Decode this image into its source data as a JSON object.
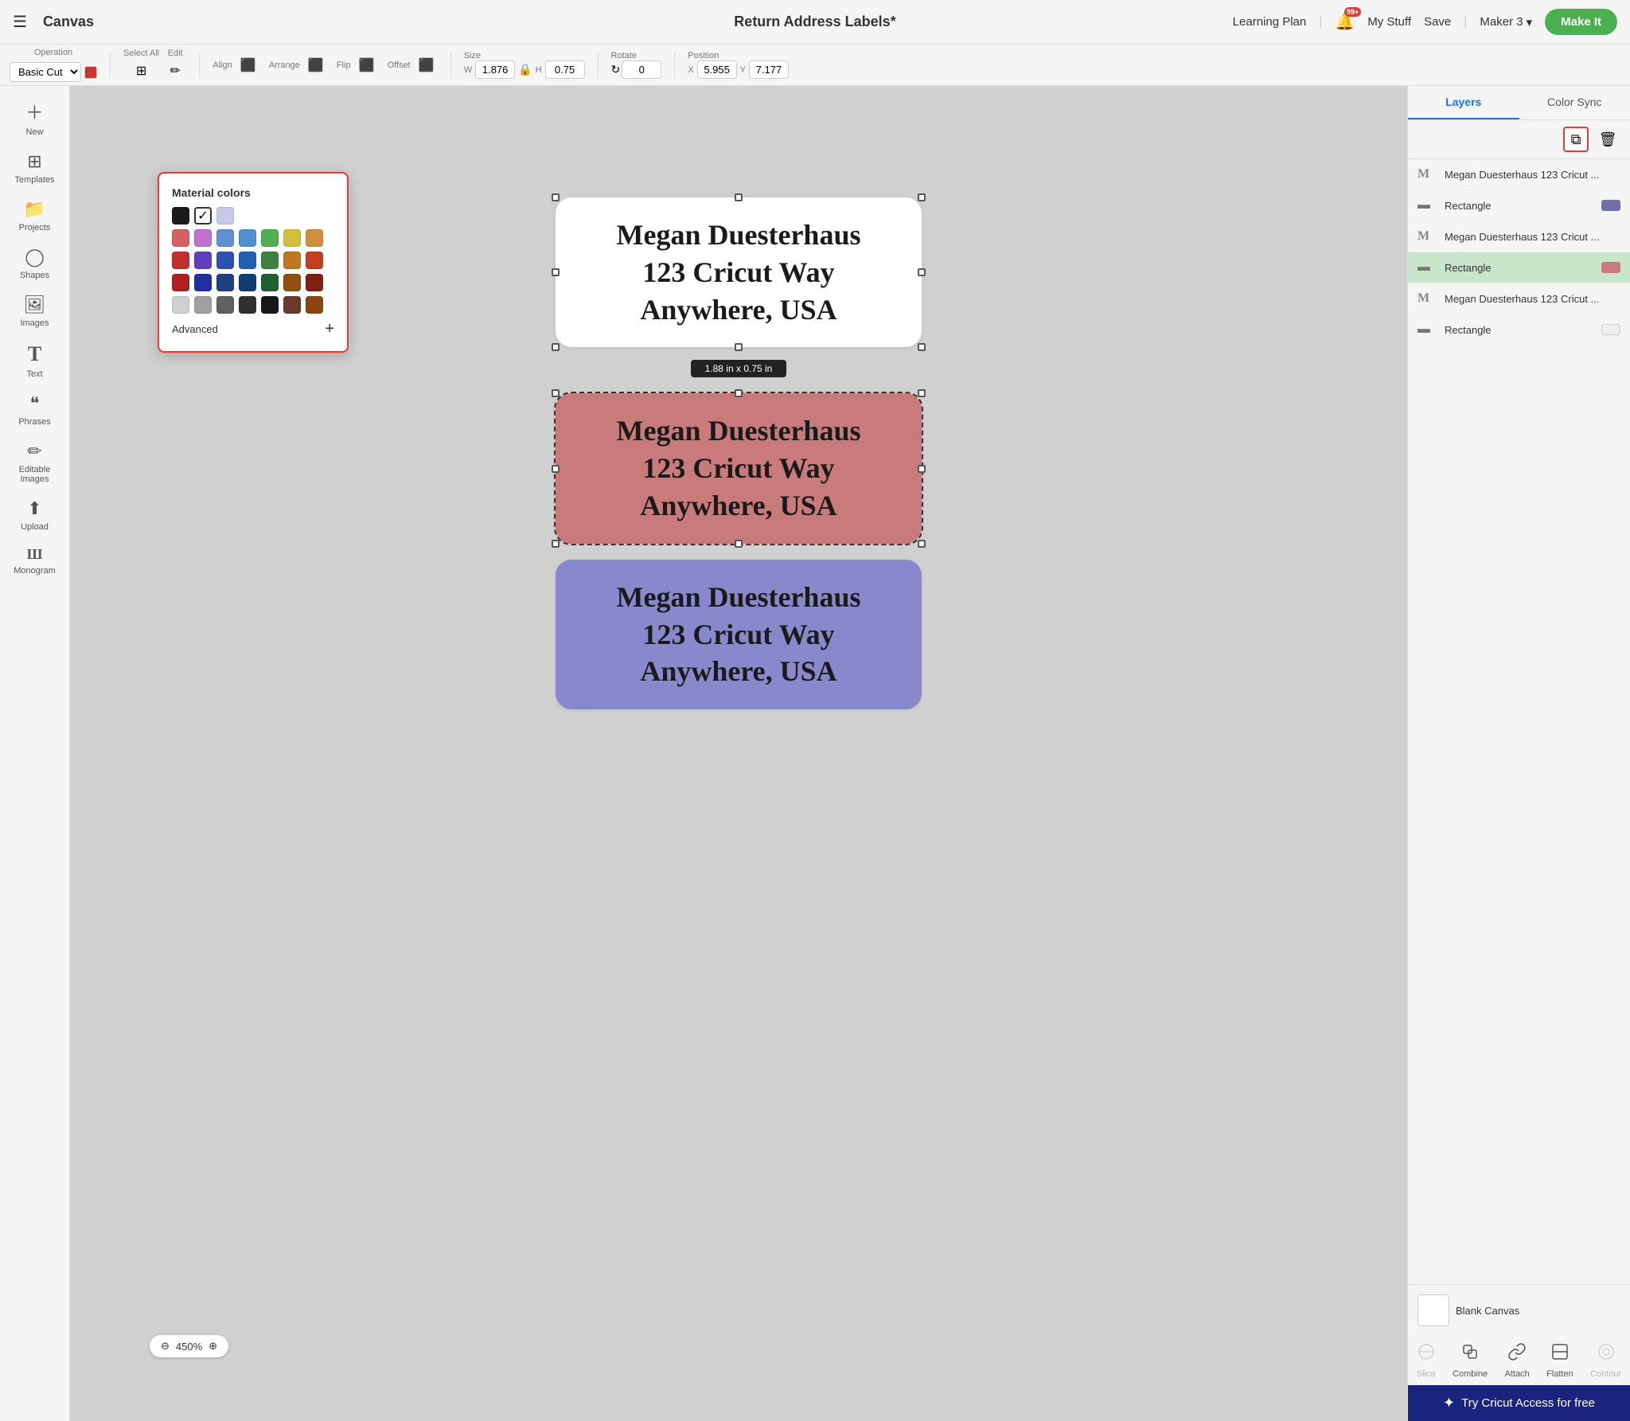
{
  "topbar": {
    "hamburger": "☰",
    "canvas_title": "Canvas",
    "doc_title": "Return Address Labels*",
    "learning_plan": "Learning Plan",
    "divider1": "|",
    "notification_badge": "99+",
    "my_stuff": "My Stuff",
    "save": "Save",
    "divider2": "|",
    "maker": "Maker 3",
    "make_it": "Make It"
  },
  "toolbar": {
    "operation_label": "Operation",
    "operation_value": "Basic Cut",
    "select_all": "Select All",
    "edit": "Edit",
    "align": "Align",
    "arrange": "Arrange",
    "flip": "Flip",
    "offset": "Offset",
    "size_label": "Size",
    "width_value": "1.876",
    "height_value": "0.75",
    "lock_icon": "🔒",
    "rotate_label": "Rotate",
    "rotate_value": "0",
    "position_label": "Position",
    "x_value": "5.955",
    "y_value": "7.177"
  },
  "sidebar": {
    "items": [
      {
        "id": "new",
        "icon": "＋",
        "label": "New"
      },
      {
        "id": "templates",
        "icon": "⊞",
        "label": "Templates"
      },
      {
        "id": "projects",
        "icon": "📁",
        "label": "Projects"
      },
      {
        "id": "shapes",
        "icon": "◯",
        "label": "Shapes"
      },
      {
        "id": "images",
        "icon": "🖼",
        "label": "Images"
      },
      {
        "id": "text",
        "icon": "T",
        "label": "Text"
      },
      {
        "id": "phrases",
        "icon": "❝",
        "label": "Phrases"
      },
      {
        "id": "editable-images",
        "icon": "✏",
        "label": "Editable Images"
      },
      {
        "id": "upload",
        "icon": "⬆",
        "label": "Upload"
      },
      {
        "id": "monogram",
        "icon": "Ш",
        "label": "Monogram"
      }
    ]
  },
  "canvas": {
    "zoom": "450%",
    "zoom_minus": "⊖",
    "zoom_plus": "⊕",
    "size_tooltip": "1.88 in x 0.75 in",
    "label_text_line1": "Megan Duesterhaus",
    "label_text_line2": "123 Cricut Way",
    "label_text_line3": "Anywhere, USA"
  },
  "color_picker": {
    "title": "Material colors",
    "colors_row1": [
      "#1a1a1a",
      "#ffffff",
      "#c8c8e8"
    ],
    "colors_row2_checked": "#1a1a1a",
    "colors_row3": [
      "#d46060",
      "#c070d0",
      "#6090d0",
      "#50b050",
      "#d0c040",
      "#d09040"
    ],
    "colors_row4": [
      "#c03030",
      "#6040c0",
      "#3050b0",
      "#408040",
      "#c07820",
      "#c04020"
    ],
    "colors_row5": [
      "#b02020",
      "#2030a0",
      "#204080",
      "#206030",
      "#905010",
      "#802010"
    ],
    "colors_row6": [
      "#d0d0d0",
      "#a0a0a0",
      "#606060",
      "#303030",
      "#181818",
      "#8b4513"
    ],
    "advanced_label": "Advanced",
    "add_icon": "+"
  },
  "layers": {
    "tab_layers": "Layers",
    "tab_color_sync": "Color Sync",
    "items": [
      {
        "id": 1,
        "type": "text",
        "name": "Megan Duesterhaus 123 Cricut ...",
        "color": null
      },
      {
        "id": 2,
        "type": "rect",
        "name": "Rectangle",
        "color": "#7070aa"
      },
      {
        "id": 3,
        "type": "text",
        "name": "Megan Duesterhaus 123 Cricut ...",
        "color": null
      },
      {
        "id": 4,
        "type": "rect",
        "name": "Rectangle",
        "color": "#c97a7a",
        "selected": true
      },
      {
        "id": 5,
        "type": "text",
        "name": "Megan Duesterhaus 123 Cricut ...",
        "color": null
      },
      {
        "id": 6,
        "type": "rect",
        "name": "Rectangle",
        "color": null
      }
    ],
    "blank_canvas_label": "Blank Canvas",
    "actions": [
      {
        "id": "slice",
        "icon": "⬡",
        "label": "Slice",
        "disabled": true
      },
      {
        "id": "combine",
        "icon": "⬡",
        "label": "Combine",
        "disabled": false
      },
      {
        "id": "attach",
        "icon": "📌",
        "label": "Attach",
        "disabled": false
      },
      {
        "id": "flatten",
        "icon": "⬛",
        "label": "Flatten",
        "disabled": false
      },
      {
        "id": "contour",
        "icon": "◎",
        "label": "Contour",
        "disabled": true
      }
    ]
  },
  "cricut_bar": {
    "icon": "✦",
    "label": "Try Cricut Access for free"
  }
}
